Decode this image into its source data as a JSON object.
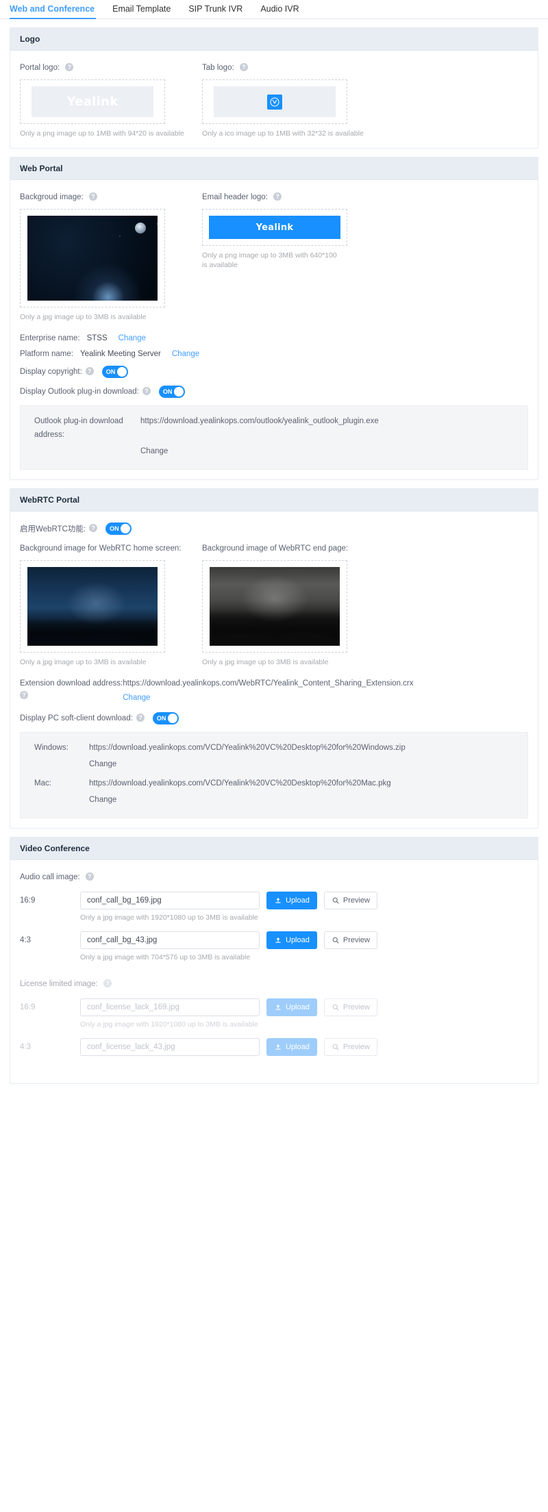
{
  "tabs": [
    {
      "label": "Web and Conference",
      "active": true
    },
    {
      "label": "Email Template",
      "active": false
    },
    {
      "label": "SIP Trunk IVR",
      "active": false
    },
    {
      "label": "Audio IVR",
      "active": false
    }
  ],
  "colors": {
    "accent": "#409eff",
    "button_blue": "#1890ff",
    "panel_header_bg": "#e8edf3",
    "hint_gray": "#a6a9ad"
  },
  "icons": {
    "help": "?",
    "upload": "upload-icon",
    "preview": "magnifier-icon"
  },
  "logo_panel": {
    "title": "Logo",
    "portal_logo": {
      "label": "Portal logo:",
      "image_text": "Yealink",
      "hint": "Only a png image up to 1MB with 94*20 is available"
    },
    "tab_logo": {
      "label": "Tab logo:",
      "image_text": "",
      "hint": "Only a ico image up to 1MB with 32*32 is available"
    }
  },
  "web_portal_panel": {
    "title": "Web Portal",
    "background_image": {
      "label": "Backgroud image:",
      "hint": "Only a jpg image up to 3MB is available"
    },
    "email_header_logo": {
      "label": "Email header logo:",
      "image_text": "Yealink",
      "hint": "Only a png image up to 3MB with 640*100 is available"
    },
    "enterprise_name": {
      "label": "Enterprise name:",
      "value": "STSS",
      "action": "Change"
    },
    "platform_name": {
      "label": "Platform name:",
      "value": "Yealink Meeting Server",
      "action": "Change"
    },
    "display_copyright": {
      "label": "Display copyright:",
      "toggle": "ON"
    },
    "display_outlook_plugin": {
      "label": "Display Outlook plug-in download:",
      "toggle": "ON"
    },
    "outlook_download": {
      "label": "Outlook plug-in download address:",
      "value": "https://download.yealinkops.com/outlook/yealink_outlook_plugin.exe",
      "action": "Change"
    }
  },
  "webrtc_panel": {
    "title": "WebRTC Portal",
    "enable_webrtc": {
      "label": "启用WebRTC功能:",
      "toggle": "ON"
    },
    "home_screen_bg": {
      "label": "Background image for WebRTC home screen:",
      "hint": "Only a jpg image up to 3MB is available"
    },
    "end_page_bg": {
      "label": "Background image of WebRTC end page:",
      "hint": "Only a jpg image up to 3MB is available"
    },
    "extension_download": {
      "label": "Extension download address:",
      "value": "https://download.yealinkops.com/WebRTC/Yealink_Content_Sharing_Extension.crx",
      "action": "Change"
    },
    "display_pc_client": {
      "label": "Display PC soft-client download:",
      "toggle": "ON"
    },
    "pc_client_windows": {
      "label": "Windows:",
      "value": "https://download.yealinkops.com/VCD/Yealink%20VC%20Desktop%20for%20Windows.zip",
      "action": "Change"
    },
    "pc_client_mac": {
      "label": "Mac:",
      "value": "https://download.yealinkops.com/VCD/Yealink%20VC%20Desktop%20for%20Mac.pkg",
      "action": "Change"
    }
  },
  "video_conference_panel": {
    "title": "Video Conference",
    "audio_call_image": {
      "label": "Audio call image:",
      "items": [
        {
          "ratio": "16:9",
          "value": "conf_call_bg_169.jpg",
          "hint": "Only a jpg image with 1920*1080 up to 3MB is available",
          "upload_label": "Upload",
          "preview_label": "Preview",
          "disabled": false
        },
        {
          "ratio": "4:3",
          "value": "conf_call_bg_43.jpg",
          "hint": "Only a jpg image with 704*576 up to 3MB is available",
          "upload_label": "Upload",
          "preview_label": "Preview",
          "disabled": false
        }
      ]
    },
    "license_limited_image": {
      "label": "License limited image:",
      "items": [
        {
          "ratio": "16:9",
          "value": "conf_license_lack_169.jpg",
          "hint": "Only a jpg image with 1920*1080 up to 3MB is available",
          "upload_label": "Upload",
          "preview_label": "Preview",
          "disabled": true
        },
        {
          "ratio": "4:3",
          "value": "conf_license_lack_43.jpg",
          "hint": "",
          "upload_label": "Upload",
          "preview_label": "Preview",
          "disabled": true
        }
      ]
    }
  }
}
